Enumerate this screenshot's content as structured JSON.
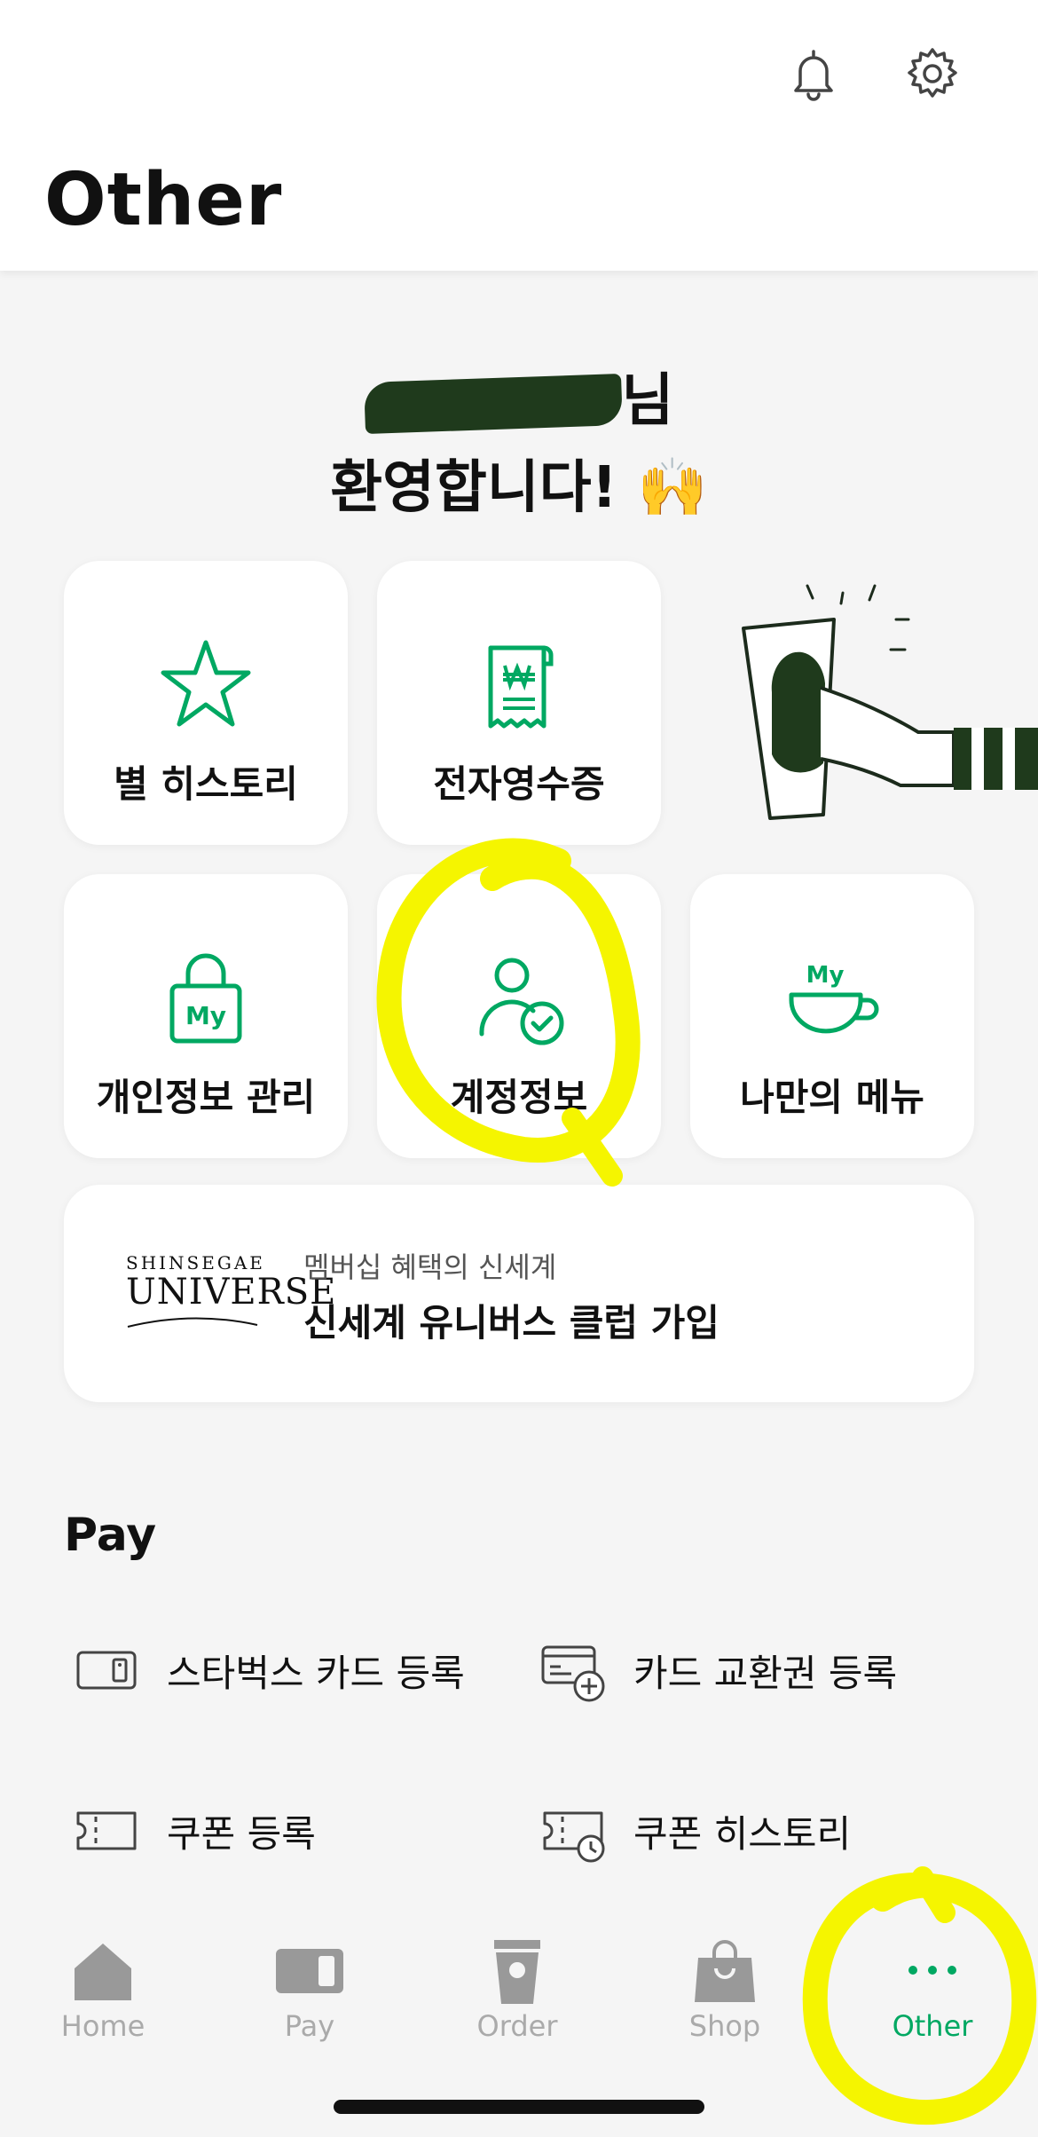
{
  "colors": {
    "accent": "#00a862",
    "highlight": "#f5f500",
    "redaction": "#1f3a1c"
  },
  "header": {
    "title": "Other",
    "icons": [
      "bell-icon",
      "gear-icon"
    ]
  },
  "welcome": {
    "name_suffix": "님",
    "greeting": "환영합니다!",
    "emoji": "🙌"
  },
  "tiles": [
    {
      "label": "별 히스토리",
      "icon": "star-icon"
    },
    {
      "label": "전자영수증",
      "icon": "receipt-icon"
    },
    {
      "label": "개인정보 관리",
      "icon": "lock-my-icon"
    },
    {
      "label": "계정정보",
      "icon": "account-check-icon"
    },
    {
      "label": "나만의 메뉴",
      "icon": "my-cup-icon"
    }
  ],
  "universe": {
    "logo_top": "SHINSEGAE",
    "logo_main": "UNIVERSE",
    "subtitle": "멤버십 혜택의 신세계",
    "title": "신세계 유니버스 클럽 가입"
  },
  "pay": {
    "title": "Pay",
    "items": [
      {
        "label": "스타벅스 카드 등록",
        "icon": "card-icon"
      },
      {
        "label": "카드 교환권 등록",
        "icon": "card-plus-icon"
      },
      {
        "label": "쿠폰 등록",
        "icon": "coupon-icon"
      },
      {
        "label": "쿠폰 히스토리",
        "icon": "coupon-history-icon"
      }
    ]
  },
  "tabbar": [
    {
      "label": "Home",
      "icon": "home-icon",
      "active": false
    },
    {
      "label": "Pay",
      "icon": "pay-card-icon",
      "active": false
    },
    {
      "label": "Order",
      "icon": "cup-icon",
      "active": false
    },
    {
      "label": "Shop",
      "icon": "bag-icon",
      "active": false
    },
    {
      "label": "Other",
      "icon": "more-dots-icon",
      "active": true
    }
  ]
}
